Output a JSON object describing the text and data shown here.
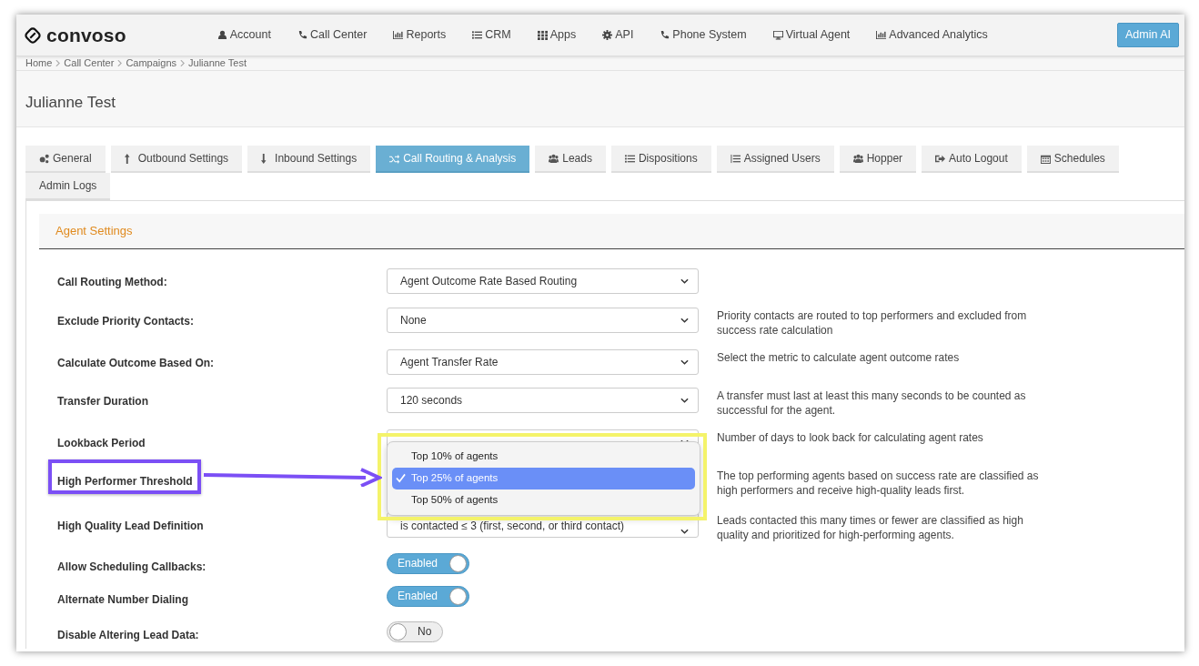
{
  "logo": {
    "text": "convoso"
  },
  "nav": [
    {
      "label": "Account",
      "kind": "user"
    },
    {
      "label": "Call Center",
      "kind": "phone"
    },
    {
      "label": "Reports",
      "kind": "chart"
    },
    {
      "label": "CRM",
      "kind": "list"
    },
    {
      "label": "Apps",
      "kind": "grid"
    },
    {
      "label": "API",
      "kind": "gear"
    },
    {
      "label": "Phone System",
      "kind": "phone"
    },
    {
      "label": "Virtual Agent",
      "kind": "monitor"
    },
    {
      "label": "Advanced Analytics",
      "kind": "chart"
    }
  ],
  "admin_button": "Admin AI",
  "breadcrumb": [
    "Home",
    "Call Center",
    "Campaigns",
    "Julianne Test"
  ],
  "page_title": "Julianne Test",
  "tabs": [
    {
      "label": "General",
      "kind": "gears",
      "selected": false
    },
    {
      "label": "Outbound Settings",
      "kind": "up",
      "selected": false
    },
    {
      "label": "Inbound Settings",
      "kind": "down",
      "selected": false
    },
    {
      "label": "Call Routing & Analysis",
      "kind": "shuffle",
      "selected": true
    },
    {
      "label": "Leads",
      "kind": "users",
      "selected": false
    },
    {
      "label": "Dispositions",
      "kind": "list",
      "selected": false
    },
    {
      "label": "Assigned Users",
      "kind": "olist",
      "selected": false
    },
    {
      "label": "Hopper",
      "kind": "users",
      "selected": false
    },
    {
      "label": "Auto Logout",
      "kind": "logout",
      "selected": false
    },
    {
      "label": "Schedules",
      "kind": "calendar",
      "selected": false
    },
    {
      "label": "Admin Logs",
      "kind": "plain",
      "selected": false
    }
  ],
  "section_title": "Agent Settings",
  "settings": [
    {
      "kind": "select",
      "label": "Call Routing Method:",
      "value": "Agent Outcome Rate Based Routing"
    },
    {
      "kind": "select",
      "label": "Exclude Priority Contacts:",
      "value": "None",
      "help": "Priority contacts are routed to top performers and excluded from success rate calculation"
    },
    {
      "kind": "select",
      "label": "Calculate Outcome Based On:",
      "value": "Agent Transfer Rate",
      "help": "Select the metric to calculate agent outcome rates"
    },
    {
      "kind": "select",
      "label": "Transfer Duration",
      "value": "120 seconds",
      "help": "A transfer must last at least this many seconds to be counted as successful for the agent."
    },
    {
      "kind": "select",
      "label": "Lookback Period",
      "help": "Number of days to look back for calculating agent rates"
    },
    {
      "kind": "select",
      "label": "High Performer Threshold",
      "help": "The top performing agents based on success rate are classified as high performers and receive high-quality leads first.",
      "dropdown": [
        {
          "label": "Top 10% of agents",
          "selected": false
        },
        {
          "label": "Top 25% of agents",
          "selected": true
        },
        {
          "label": "Top 50% of agents",
          "selected": false
        }
      ]
    },
    {
      "kind": "select",
      "label": "High Quality Lead Definition",
      "value": "is contacted ≤ 3 (first, second, or third contact)",
      "help": "Leads contacted this many times or fewer are classified as high quality and prioritized for high-performing agents."
    },
    {
      "kind": "toggle",
      "label": "Allow Scheduling Callbacks:",
      "on": true,
      "value": "Enabled"
    },
    {
      "kind": "toggle",
      "label": "Alternate Number Dialing",
      "on": true,
      "value": "Enabled"
    },
    {
      "kind": "toggle",
      "label": "Disable Altering Lead Data:",
      "on": false,
      "value": "No"
    }
  ]
}
